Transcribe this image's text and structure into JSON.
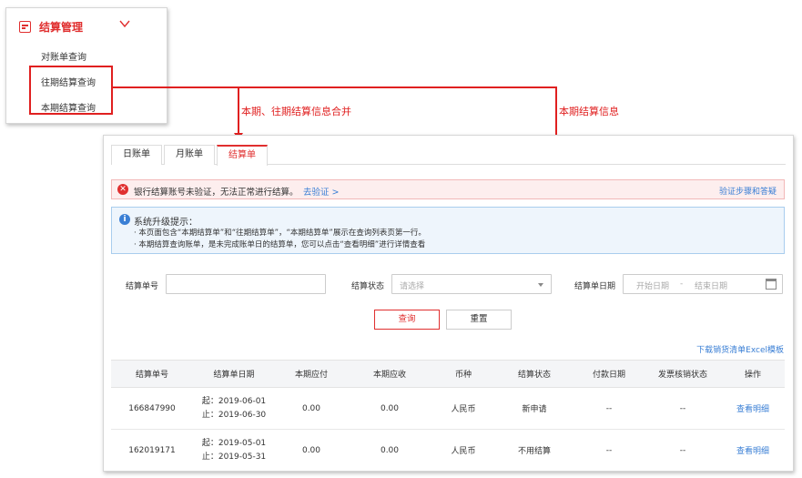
{
  "menu": {
    "title": "结算管理",
    "items": [
      "对账单查询",
      "往期结算查询",
      "本期结算查询"
    ]
  },
  "annotations": {
    "merge_label": "本期、往期结算信息合并",
    "current_label": "本期结算信息"
  },
  "tabs": [
    "日账单",
    "月账单",
    "结算单"
  ],
  "active_tab": "结算单",
  "error_alert": {
    "message": "银行结算账号未验证，无法正常进行结算。",
    "link": "去验证 >",
    "right_link": "验证步骤和答疑"
  },
  "info_alert": {
    "title": "系统升级提示：",
    "lines": [
      "· 本页面包含“本期结算单”和“往期结算单”，“本期结算单”展示在查询列表页第一行。",
      "· 本期结算查询账单，是未完成账单日的结算单，您可以点击“查看明细”进行详情查看"
    ]
  },
  "filters": {
    "settle_no_label": "结算单号",
    "status_label": "结算状态",
    "status_placeholder": "请选择",
    "date_label": "结算单日期",
    "start_placeholder": "开始日期",
    "separator": "-",
    "end_placeholder": "结束日期"
  },
  "buttons": {
    "query": "查询",
    "reset": "重置"
  },
  "download_link": "下载销货清单Excel模板",
  "table": {
    "headers": [
      "结算单号",
      "结算单日期",
      "本期应付",
      "本期应收",
      "币种",
      "结算状态",
      "付款日期",
      "发票核销状态",
      "操作"
    ],
    "rows": [
      {
        "no": "166847990",
        "date_start": "起：2019-06-01",
        "date_end": "止：2019-06-30",
        "payable": "0.00",
        "receivable": "0.00",
        "currency": "人民币",
        "status": "新申请",
        "pay_date": "--",
        "invoice": "--",
        "action": "查看明细"
      },
      {
        "no": "162019171",
        "date_start": "起：2019-05-01",
        "date_end": "止：2019-05-31",
        "payable": "0.00",
        "receivable": "0.00",
        "currency": "人民币",
        "status": "不用结算",
        "pay_date": "--",
        "invoice": "--",
        "action": "查看明细"
      }
    ]
  },
  "colors": {
    "accent": "#e02f2f",
    "link": "#3a7fd5",
    "annotation": "#e02020"
  },
  "icons": {
    "menu": "settlement-icon",
    "chevron": "chevron-down-icon",
    "error": "close-circle-icon",
    "info": "info-circle-icon",
    "calendar": "calendar-icon"
  }
}
